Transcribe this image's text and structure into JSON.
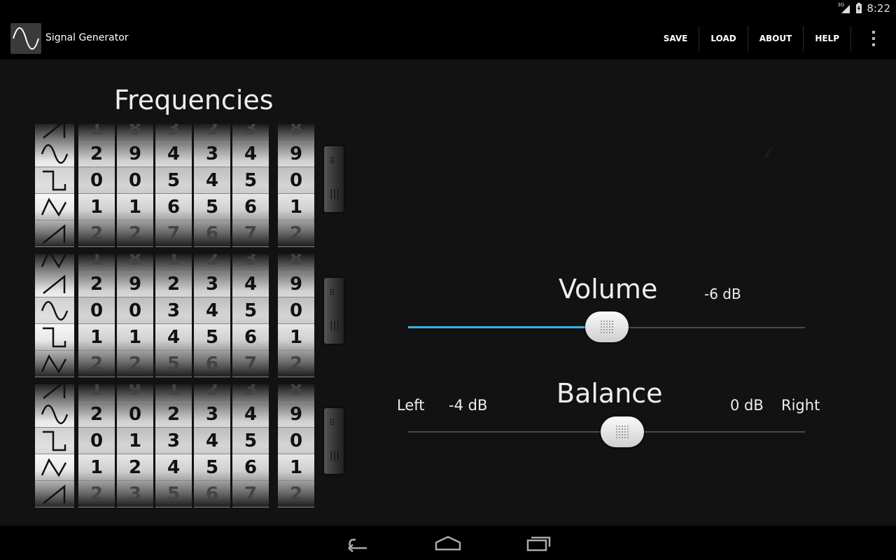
{
  "status_bar": {
    "network_type": "3G",
    "time": "8:22"
  },
  "action_bar": {
    "title": "Signal Generator",
    "actions": [
      "SAVE",
      "LOAD",
      "ABOUT",
      "HELP"
    ],
    "app_icon": "sine-wave-icon",
    "overflow_icon": "overflow-menu-icon"
  },
  "frequencies": {
    "title": "Frequencies",
    "channels": [
      {
        "wave_icons": [
          "sawtooth-wave-icon",
          "sine-wave-icon",
          "square-wave-icon",
          "triangle-wave-icon",
          "sawtooth-wave-icon"
        ],
        "digits": [
          [
            "1",
            "2",
            "0",
            "1",
            "2"
          ],
          [
            "8",
            "9",
            "0",
            "1",
            "2"
          ],
          [
            "3",
            "4",
            "5",
            "6",
            "7"
          ],
          [
            "2",
            "3",
            "4",
            "5",
            "6"
          ],
          [
            "3",
            "4",
            "5",
            "6",
            "7"
          ],
          [
            "8",
            "9",
            "0",
            "1",
            "2"
          ]
        ]
      },
      {
        "wave_icons": [
          "triangle-wave-icon",
          "sawtooth-wave-icon",
          "sine-wave-icon",
          "square-wave-icon",
          "triangle-wave-icon"
        ],
        "digits": [
          [
            "1",
            "2",
            "0",
            "1",
            "2"
          ],
          [
            "8",
            "9",
            "0",
            "1",
            "2"
          ],
          [
            "1",
            "2",
            "3",
            "4",
            "5"
          ],
          [
            "2",
            "3",
            "4",
            "5",
            "6"
          ],
          [
            "3",
            "4",
            "5",
            "6",
            "7"
          ],
          [
            "8",
            "9",
            "0",
            "1",
            "2"
          ]
        ]
      },
      {
        "wave_icons": [
          "sawtooth-wave-icon",
          "sine-wave-icon",
          "square-wave-icon",
          "triangle-wave-icon",
          "sawtooth-wave-icon"
        ],
        "digits": [
          [
            "1",
            "2",
            "0",
            "1",
            "2"
          ],
          [
            "9",
            "0",
            "1",
            "2",
            "3"
          ],
          [
            "1",
            "2",
            "3",
            "4",
            "5"
          ],
          [
            "2",
            "3",
            "4",
            "5",
            "6"
          ],
          [
            "3",
            "4",
            "5",
            "6",
            "7"
          ],
          [
            "8",
            "9",
            "0",
            "1",
            "2"
          ]
        ]
      }
    ]
  },
  "volume": {
    "label": "Volume",
    "value_text": "-6 dB",
    "level": 0.5
  },
  "balance": {
    "label": "Balance",
    "left_label": "Left",
    "left_value": "-4 dB",
    "right_value": "0 dB",
    "right_label": "Right",
    "position": 0.54
  },
  "nav_bar": {
    "back_icon": "back-icon",
    "home_icon": "home-icon",
    "recents_icon": "recent-apps-icon"
  },
  "colors": {
    "accent": "#33b5e5",
    "background": "#121212",
    "bar": "#000000"
  }
}
